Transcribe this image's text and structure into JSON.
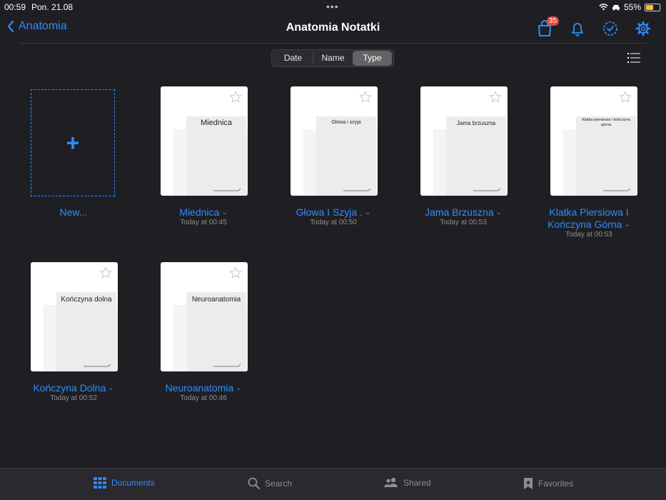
{
  "status": {
    "time": "00:59",
    "date": "Pon. 21.08",
    "battery": "55%",
    "battery_level": 0.55
  },
  "nav": {
    "back_label": "Anatomia",
    "title": "Anatomia Notatki",
    "badge_count": "35"
  },
  "sort": {
    "options": [
      "Date",
      "Name",
      "Type"
    ],
    "selected": "Type"
  },
  "new_label": "New...",
  "documents": [
    {
      "name": "Miednica",
      "time": "Today at 00:45",
      "heading": "Miednica"
    },
    {
      "name": "Głowa I Szyja .",
      "time": "Today at 00:50",
      "heading": "Głowa i szyja"
    },
    {
      "name": "Jama Brzuszna",
      "time": "Today at 00:53",
      "heading": "Jama brzuszna"
    },
    {
      "name": "Klatka Piersiowa I Kończyna Górna",
      "time": "Today at 00:53",
      "heading": "Klatka piersiowa i kończyna górna"
    },
    {
      "name": "Kończyna Dolna",
      "time": "Today at 00:52",
      "heading": "Kończyna dolna"
    },
    {
      "name": "Neuroanatomia",
      "time": "Today at 00:46",
      "heading": "Neuroanatomia"
    }
  ],
  "tabs": {
    "documents": "Documents",
    "search": "Search",
    "shared": "Shared",
    "favorites": "Favorites"
  },
  "colors": {
    "accent": "#2f8cff",
    "background": "#1f1f23",
    "badge": "#e5453c"
  },
  "icons": [
    "back-chevron-icon",
    "shopping-bag-icon",
    "bell-icon",
    "check-circle-icon",
    "gear-icon",
    "list-icon",
    "plus-icon",
    "star-icon",
    "grid-icon",
    "search-icon",
    "people-icon",
    "bookmark-star-icon"
  ]
}
